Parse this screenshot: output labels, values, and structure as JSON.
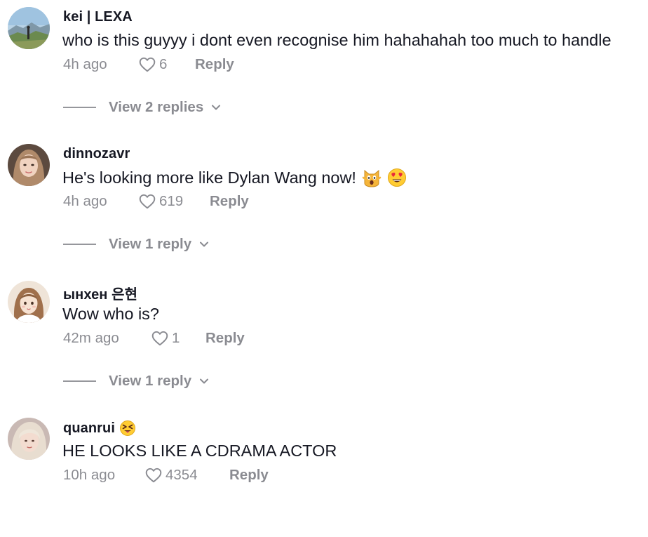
{
  "comments": [
    {
      "username": "kei | LEXA",
      "text": "who is this guyyy i dont even recognise him hahahahah too much to handle",
      "time": "4h ago",
      "likes": "6",
      "reply_label": "Reply",
      "view_replies": "View 2 replies",
      "avatar_icon": "mountain-landscape-avatar"
    },
    {
      "username": "dinnozavr",
      "text": "He's looking more like Dylan Wang now!",
      "text_emojis": [
        "scream-cat-emoji",
        "heart-eyes-emoji"
      ],
      "time": "4h ago",
      "likes": "619",
      "reply_label": "Reply",
      "view_replies": "View 1 reply",
      "avatar_icon": "woman-portrait-avatar"
    },
    {
      "username": "ынхен 은현",
      "text": "Wow who is?",
      "time": "42m ago",
      "likes": "1",
      "reply_label": "Reply",
      "view_replies": "View 1 reply",
      "avatar_icon": "illustrated-girl-avatar"
    },
    {
      "username": "quanrui",
      "username_emoji": "squinting-tongue-emoji",
      "text": "HE LOOKS LIKE A CDRAMA ACTOR",
      "time": "10h ago",
      "likes": "4354",
      "reply_label": "Reply",
      "avatar_icon": "blonde-person-avatar"
    }
  ],
  "colors": {
    "primary_text": "#161823",
    "secondary_text": "#8a8b91",
    "background": "#ffffff"
  }
}
